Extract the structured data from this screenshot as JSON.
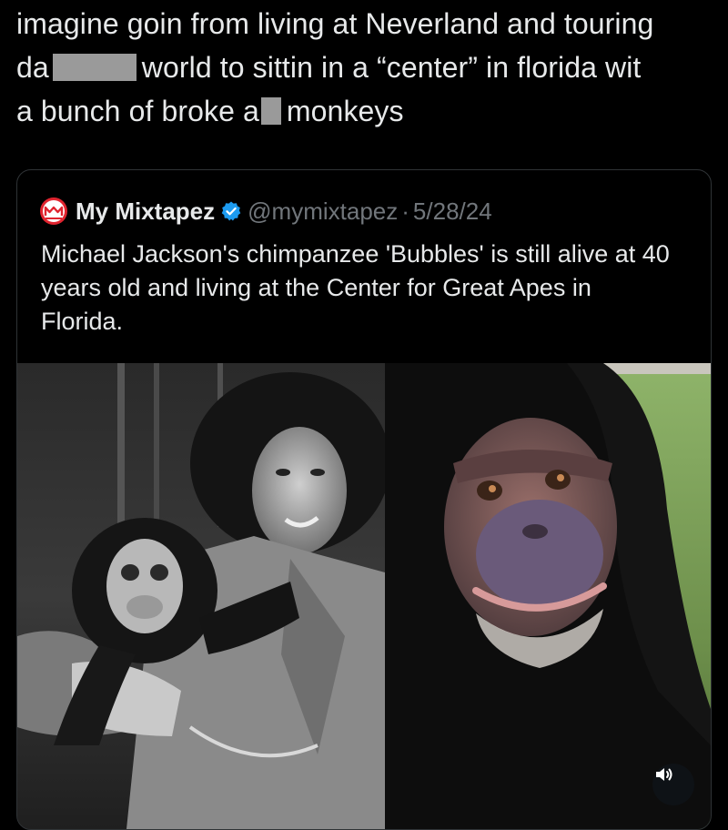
{
  "post": {
    "line1": "imagine goin from living at Neverland and touring",
    "line2_start": "da",
    "line2_end": "world to sittin in a “center” in florida wit",
    "line3_start": "a bunch of broke a",
    "line3_end": "monkeys"
  },
  "quote": {
    "avatar_icon": "mm-logo-icon",
    "display_name": "My Mixtapez",
    "verified_icon": "verified-badge-icon",
    "handle": "@mymixtapez",
    "separator": "·",
    "date": "5/28/24",
    "text": "Michael Jackson's chimpanzee 'Bubbles' is still alive at 40 years old and living at the Center for Great Apes in Florida."
  },
  "media": {
    "left_photo": "young-chimpanzee-held-by-man-photo",
    "right_photo": "adult-chimpanzee-on-grass-photo",
    "audio_icon": "speaker-icon"
  },
  "colors": {
    "background": "#000000",
    "text_primary": "#e7e9ea",
    "text_secondary": "#71767b",
    "border": "#2f3336",
    "verified_blue": "#1d9bf0",
    "logo_red": "#e0242f"
  }
}
